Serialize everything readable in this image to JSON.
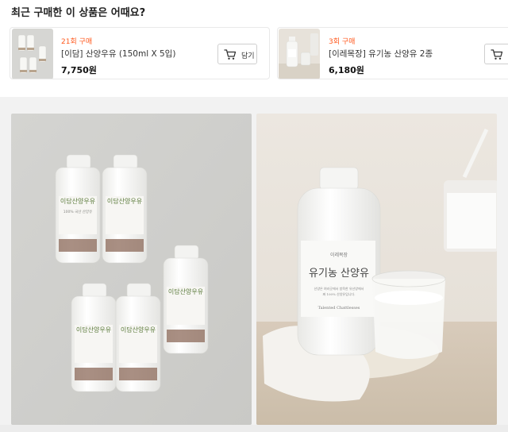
{
  "section": {
    "title": "최근 구매한 이 상품은 어때요?"
  },
  "recommendations": [
    {
      "buy_count": "21회 구매",
      "name": "[이담] 산양우유 (150ml X 5입)",
      "price": "7,750원",
      "cart_label": "담기",
      "thumb_icon": "milk-bottles-thumbnail"
    },
    {
      "buy_count": "3회 구매",
      "name": "[이레목장] 유기농 산양유 2종",
      "price": "6,180원",
      "thumb_icon": "milk-bottle-thumbnail"
    }
  ],
  "photos": [
    {
      "bottle_brand": "이담산양우유",
      "bottle_subtitle": "100% 국산 산양유"
    },
    {
      "label_brand": "이레목장",
      "label_title": "유기농 산양유",
      "label_english": "Talented Chattlesses",
      "label_notes": [
        "산양은 여러곳에서 방목한 유산양에서",
        "짜 100% 산양유입니다."
      ]
    }
  ],
  "colors": {
    "accent": "#ff5a1f",
    "card_border": "#e9e9e9",
    "page_bg": "#f2f2f2"
  }
}
